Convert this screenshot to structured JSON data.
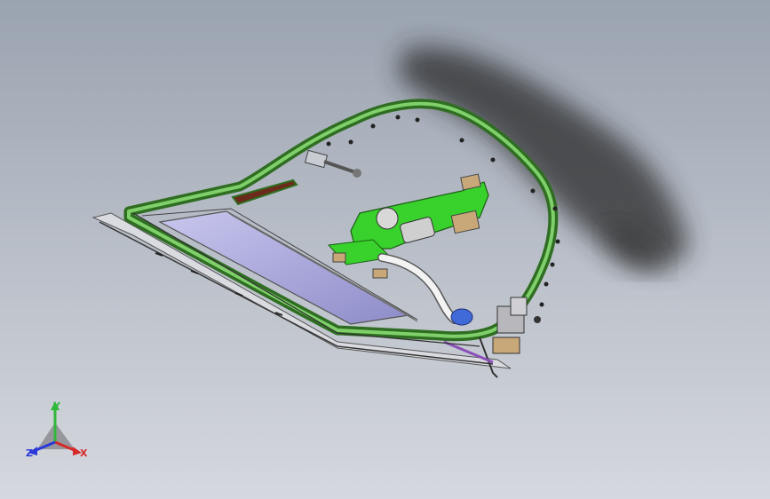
{
  "view": {
    "background_top": "#9aa3b0",
    "background_bottom": "#d5d8de",
    "model_colors": {
      "frame_green": "#3f8a2c",
      "frame_green_light": "#6fc25a",
      "bracket_green": "#39d12c",
      "glass": "#8f8ec9",
      "hose": "#f3f3f3",
      "shadow": "#2b2b2b",
      "blue_part": "#3f6ad8",
      "tan_part": "#c8a878",
      "purple_part": "#8a4fb8"
    }
  },
  "triad": {
    "y_label": "Y",
    "z_label": "Z",
    "x_label": "X",
    "y_color": "#2fb83a",
    "z_color": "#2a38d8",
    "x_color": "#d52a2a"
  }
}
